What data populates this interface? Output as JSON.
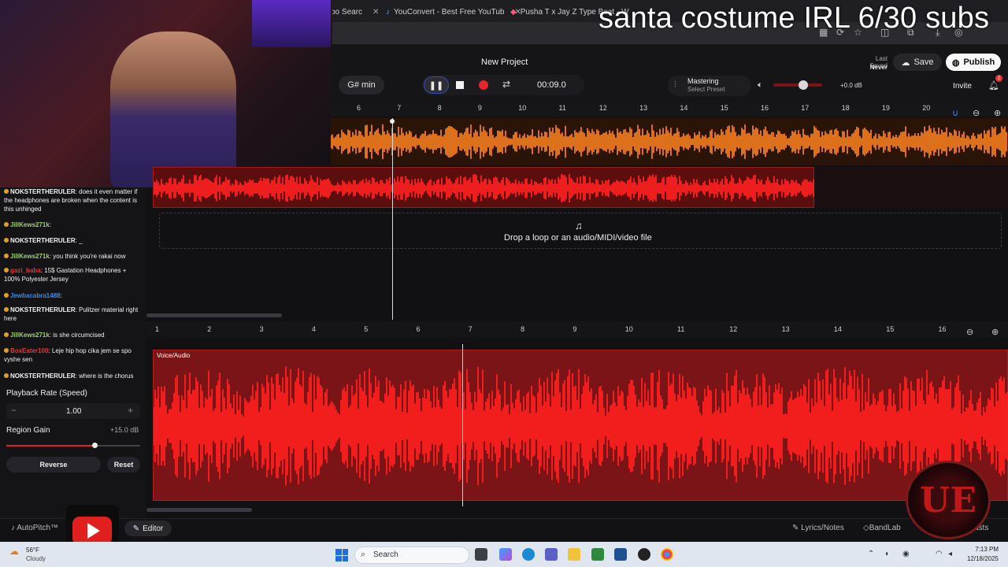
{
  "overlay": {
    "title": "santa costume IRL 6/30 subs"
  },
  "browser": {
    "tabs": [
      {
        "label": "oo Searc",
        "icon": "page-icon"
      },
      {
        "label": "YouConvert - Best Free YouTub",
        "icon": "youconvert-icon"
      },
      {
        "label": "Pusha T x Jay Z Type Beat - W",
        "icon": "bandlab-icon"
      }
    ]
  },
  "daw": {
    "project_title": "New Project",
    "key": "G# min",
    "time": "00:09.0",
    "mastering_label": "Mastering",
    "mastering_preset": "Select Preset",
    "volume_db": "+0.0 dB",
    "volume_level": 0.62,
    "last_saved_label": "Last Saved",
    "last_saved_value": "Never",
    "save_label": "Save",
    "publish_label": "Publish",
    "invite_label": "Invite",
    "notification_count": "2",
    "drop_text": "Drop a loop or an audio/MIDI/video file",
    "top_ruler": [
      "6",
      "7",
      "8",
      "9",
      "10",
      "11",
      "12",
      "13",
      "14",
      "15",
      "16",
      "17",
      "18",
      "19",
      "20"
    ],
    "bottom_ruler": [
      "1",
      "2",
      "3",
      "4",
      "5",
      "6",
      "7",
      "8",
      "9",
      "10",
      "11",
      "12",
      "13",
      "14",
      "15",
      "16"
    ],
    "region_label": "Voice/Audio",
    "colors": {
      "accent_red": "#e8252a",
      "waveform_orange": "#f07a1e",
      "waveform_red": "#ff2020"
    }
  },
  "chat": [
    {
      "user": "NOKSTERTHERULER",
      "text": ": does it even matter if the headphones are broken when the content is this unhinged",
      "color": "#f2f2f2"
    },
    {
      "user": "JillKews271k",
      "text": ": ",
      "color": "#9fd06a"
    },
    {
      "user": "NOKSTERTHERULER",
      "text": ": _",
      "color": "#f2f2f2"
    },
    {
      "user": "JillKews271k",
      "text": ": you think you're rakai now",
      "color": "#9fd06a"
    },
    {
      "user": "gazi_baba",
      "text": ": 15$ Gastation Headphones + 100% Polyester Jersey",
      "color": "#e03a3a"
    },
    {
      "user": "Jewbacabra1488",
      "text": ":",
      "color": "#3a8ce0"
    },
    {
      "user": "NOKSTERTHERULER",
      "text": ": Pulitzer material right here",
      "color": "#f2f2f2"
    },
    {
      "user": "JillKews271k",
      "text": ": is she circumcised",
      "color": "#9fd06a"
    },
    {
      "user": "BoxEater100",
      "text": ": Leje hip hop cika jem se spo vyshe sen",
      "color": "#e03a3a"
    },
    {
      "user": "NOKSTERTHERULER",
      "text": ": where is the chorus",
      "color": "#f2f2f2"
    }
  ],
  "panel": {
    "rate_label": "Playback Rate (Speed)",
    "rate_value": "1.00",
    "gain_label": "Region Gain",
    "gain_value": "+15.0 dB",
    "gain_level": 0.66,
    "reverse_label": "Reverse",
    "reset_label": "Reset"
  },
  "bottom": {
    "autopitch": "AutoPitch™",
    "editor": "Editor",
    "lyrics": "Lyrics/Notes",
    "bandlab": "BandLab",
    "podcasts": "casts"
  },
  "logo": {
    "text": "UE"
  },
  "taskbar": {
    "temp": "56°F",
    "weather": "Cloudy",
    "search": "Search",
    "time": "7:13 PM",
    "date": "12/18/2025"
  }
}
